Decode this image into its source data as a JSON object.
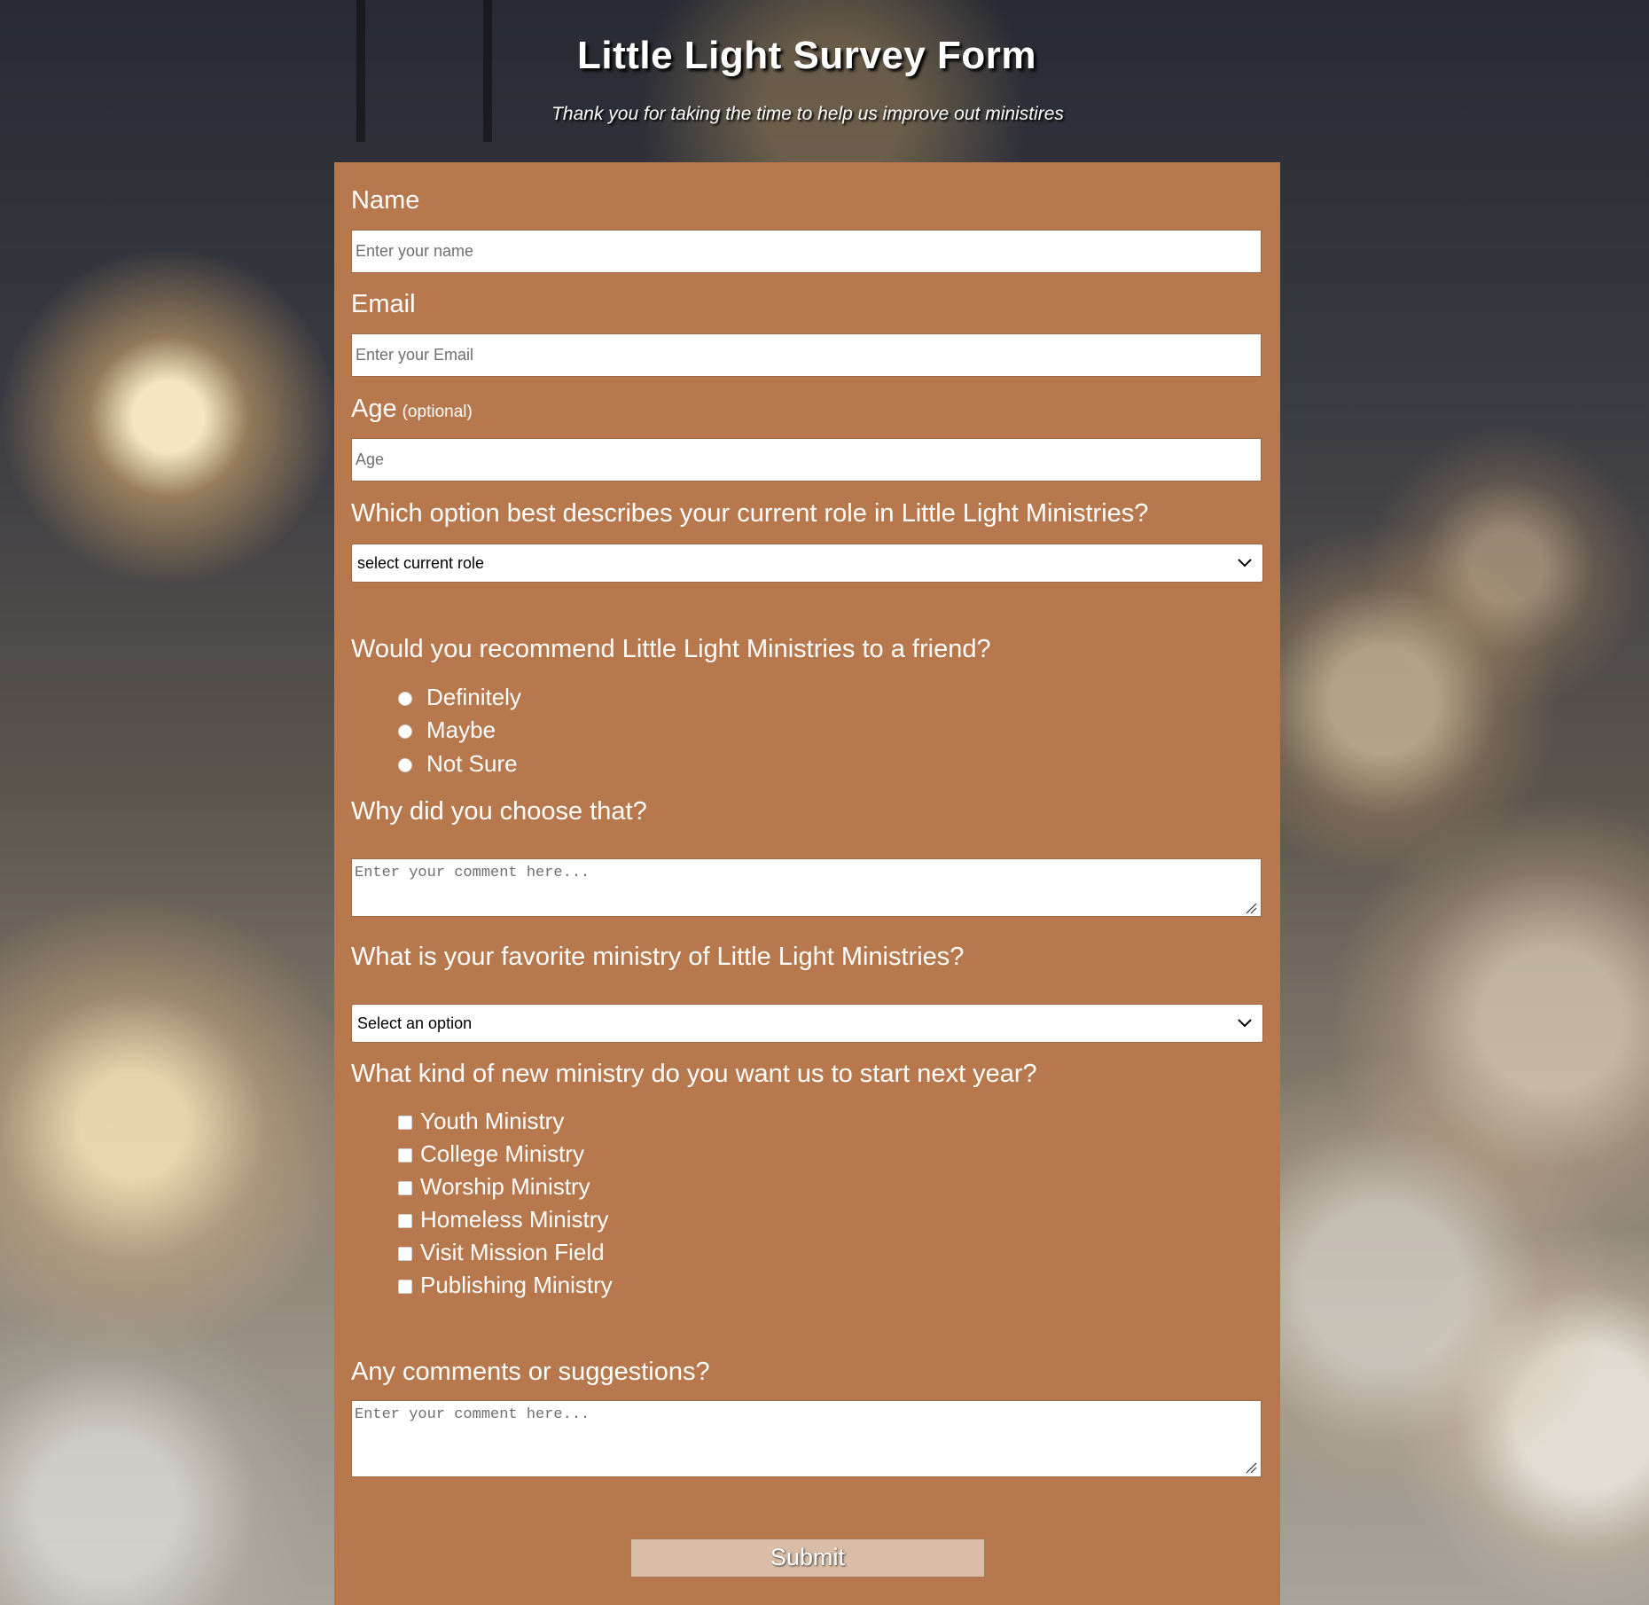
{
  "header": {
    "title": "Little Light Survey Form",
    "subtitle": "Thank you for taking the time to help us improve out ministires"
  },
  "form": {
    "name": {
      "label": "Name",
      "placeholder": "Enter your name",
      "value": ""
    },
    "email": {
      "label": "Email",
      "placeholder": "Enter your Email",
      "value": ""
    },
    "age": {
      "label": "Age",
      "optional_note": "(optional)",
      "placeholder": "Age",
      "value": ""
    },
    "role": {
      "label": "Which option best describes your current role in Little Light Ministries?",
      "selected": "select current role"
    },
    "recommend": {
      "label": "Would you recommend Little Light Ministries to a friend?",
      "options": [
        "Definitely",
        "Maybe",
        "Not Sure"
      ],
      "selected": null
    },
    "why": {
      "label": "Why did you choose that?",
      "placeholder": "Enter your comment here..."
    },
    "favorite": {
      "label": "What is your favorite ministry of Little Light Ministries?",
      "selected": "Select an option"
    },
    "new_ministry": {
      "label": "What kind of new ministry do you want us to start next year?",
      "options": [
        "Youth Ministry",
        "College Ministry",
        "Worship Ministry",
        "Homeless Ministry",
        "Visit Mission Field",
        "Publishing Ministry"
      ],
      "checked": []
    },
    "comments": {
      "label": "Any comments or suggestions?",
      "placeholder": "Enter your comment here..."
    },
    "submit_label": "Submit"
  },
  "colors": {
    "panel": "#b6784c",
    "submit_bg": "#d9bda6",
    "text": "#ffffff"
  }
}
